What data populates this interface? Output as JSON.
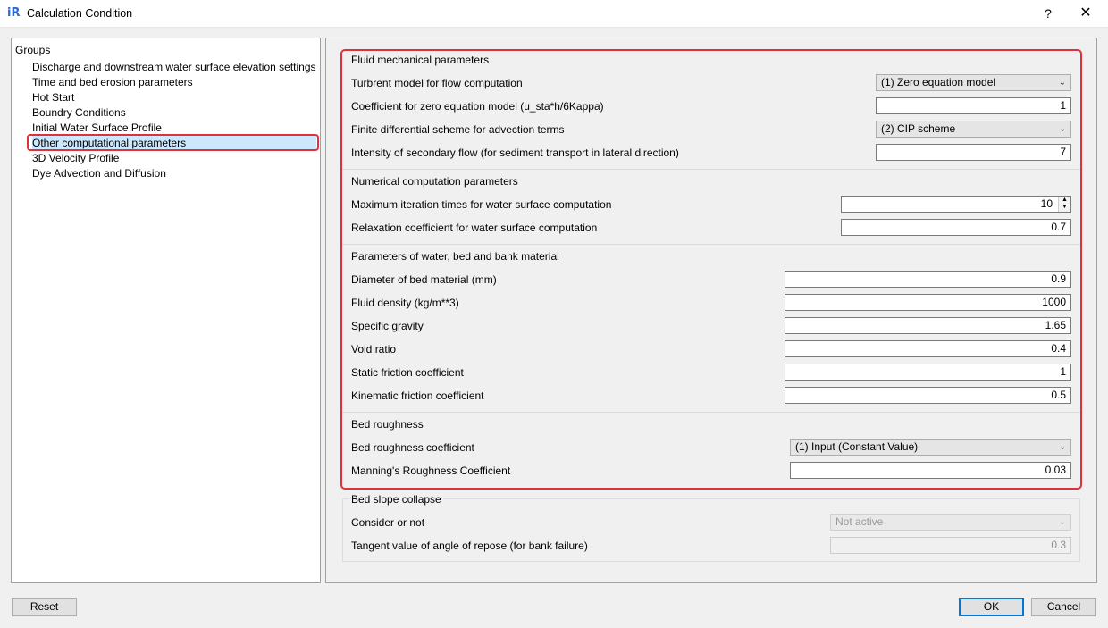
{
  "window": {
    "title": "Calculation Condition",
    "help_glyph": "?",
    "close_glyph": "✕",
    "app_icon_text": "iR"
  },
  "groups": {
    "label": "Groups",
    "items": [
      "Discharge and downstream water surface elevation settings",
      "Time and bed erosion parameters",
      "Hot Start",
      "Boundry Conditions",
      "Initial Water Surface Profile",
      "Other computational parameters",
      "3D Velocity Profile",
      "Dye Advection and Diffusion"
    ],
    "selected_index": 5
  },
  "fluid": {
    "title": "Fluid mechanical parameters",
    "turbulent_label": "Turbrent model for flow computation",
    "turbulent_value": "(1) Zero equation model",
    "coef_label": "Coefficient for zero equation model (u_sta*h/6Kappa)",
    "coef_value": "1",
    "scheme_label": "Finite differential scheme for advection terms",
    "scheme_value": "(2) CIP scheme",
    "secondary_label": "Intensity of secondary flow (for sediment transport in lateral direction)",
    "secondary_value": "7"
  },
  "numerical": {
    "title": "Numerical computation parameters",
    "iter_label": "Maximum iteration times for water surface computation",
    "iter_value": "10",
    "relax_label": "Relaxation coefficient for water surface computation",
    "relax_value": "0.7"
  },
  "material": {
    "title": "Parameters of water, bed and bank material",
    "diameter_label": "Diameter of bed material (mm)",
    "diameter_value": "0.9",
    "density_label": "Fluid density (kg/m**3)",
    "density_value": "1000",
    "gravity_label": "Specific gravity",
    "gravity_value": "1.65",
    "void_label": "Void ratio",
    "void_value": "0.4",
    "static_label": "Static friction coefficient",
    "static_value": "1",
    "kinematic_label": "Kinematic friction coefficient",
    "kinematic_value": "0.5"
  },
  "roughness": {
    "title": "Bed roughness",
    "coef_label": "Bed roughness coefficient",
    "coef_value": "(1) Input (Constant Value)",
    "manning_label": "Manning's Roughness Coefficient",
    "manning_value": "0.03"
  },
  "collapse": {
    "title": "Bed slope collapse",
    "consider_label": "Consider or not",
    "consider_value": "Not active",
    "tangent_label": "Tangent value of angle of repose (for bank failure)",
    "tangent_value": "0.3"
  },
  "buttons": {
    "reset": "Reset",
    "ok": "OK",
    "cancel": "Cancel"
  },
  "icons": {
    "chevron": "chevron-down-icon",
    "spin_up": "▲",
    "spin_down": "▼",
    "chevron_glyph": "⌵"
  },
  "colors": {
    "highlight": "#e0303a",
    "selection": "#cce8ff",
    "accent": "#0078d7"
  }
}
